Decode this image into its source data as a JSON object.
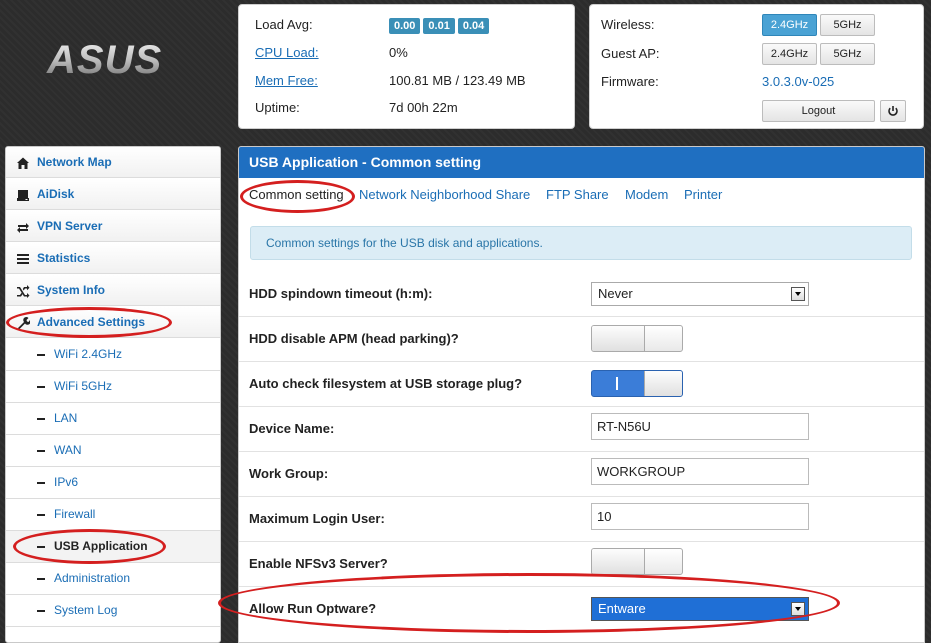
{
  "brand": {
    "logo_text": "ASUS"
  },
  "status": {
    "load_avg_label": "Load Avg:",
    "load_avg_values": [
      "0.00",
      "0.01",
      "0.04"
    ],
    "cpu_label": "CPU Load:",
    "cpu_value": "0%",
    "mem_label": "Mem Free:",
    "mem_value": "100.81 MB / 123.49 MB",
    "uptime_label": "Uptime:",
    "uptime_value": "7d 00h 22m"
  },
  "radio": {
    "wireless_label": "Wireless:",
    "guest_label": "Guest AP:",
    "firmware_label": "Firmware:",
    "firmware_value": "3.0.3.0v-025",
    "band_24": "2.4GHz",
    "band_5": "5GHz",
    "logout": "Logout"
  },
  "sidebar": {
    "items": [
      {
        "label": "Network Map",
        "icon": "home-icon"
      },
      {
        "label": "AiDisk",
        "icon": "disk-icon"
      },
      {
        "label": "VPN Server",
        "icon": "swap-icon"
      },
      {
        "label": "Statistics",
        "icon": "list-icon"
      },
      {
        "label": "System Info",
        "icon": "shuffle-icon"
      },
      {
        "label": "Advanced Settings",
        "icon": "wrench-icon"
      }
    ],
    "subitems": [
      "WiFi 2.4GHz",
      "WiFi 5GHz",
      "LAN",
      "WAN",
      "IPv6",
      "Firewall",
      "USB Application",
      "Administration",
      "System Log"
    ]
  },
  "main": {
    "title": "USB Application - Common setting",
    "tabs": [
      "Common setting",
      "Network Neighborhood Share",
      "FTP Share",
      "Modem",
      "Printer"
    ],
    "info": "Common settings for the USB disk and applications.",
    "rows": [
      {
        "label": "HDD spindown timeout (h:m):",
        "value": "Never"
      },
      {
        "label": "HDD disable APM (head parking)?",
        "value": "O"
      },
      {
        "label": "Auto check filesystem at USB storage plug?",
        "value": "I"
      },
      {
        "label": "Device Name:",
        "value": "RT-N56U"
      },
      {
        "label": "Work Group:",
        "value": "WORKGROUP"
      },
      {
        "label": "Maximum Login User:",
        "value": "10"
      },
      {
        "label": "Enable NFSv3 Server?",
        "value": "O"
      },
      {
        "label": "Allow Run Optware?",
        "value": "Entware"
      }
    ]
  },
  "colors": {
    "accent": "#1f6fc1",
    "annotation": "#d41f1f",
    "badge": "#3a8fb7"
  }
}
